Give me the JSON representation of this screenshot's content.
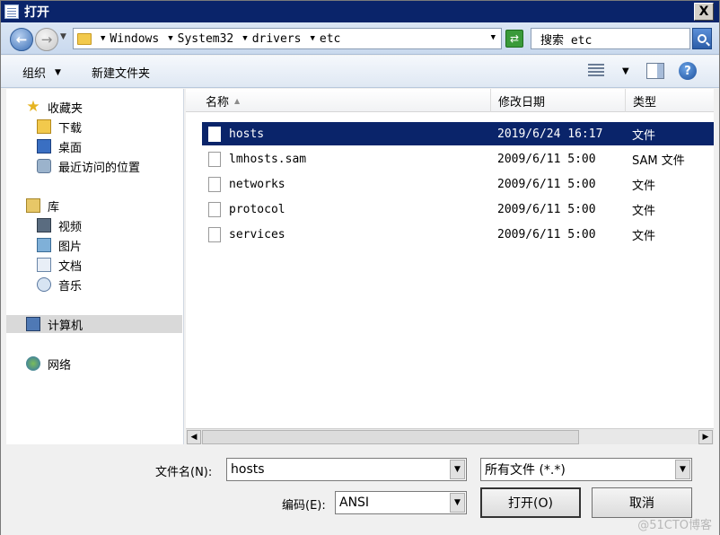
{
  "window": {
    "title": "打开",
    "close_label": "X"
  },
  "address": {
    "crumbs": [
      "Windows",
      "System32",
      "drivers",
      "etc"
    ]
  },
  "search": {
    "placeholder": "搜索 etc"
  },
  "toolbar": {
    "organize_label": "组织",
    "new_folder_label": "新建文件夹",
    "help_label": "?"
  },
  "nav": {
    "favorites": {
      "label": "收藏夹",
      "items": [
        "下载",
        "桌面",
        "最近访问的位置"
      ]
    },
    "libraries": {
      "label": "库",
      "items": [
        "视频",
        "图片",
        "文档",
        "音乐"
      ]
    },
    "computer": "计算机",
    "network": "网络"
  },
  "columns": {
    "name": "名称",
    "date": "修改日期",
    "type": "类型"
  },
  "files": [
    {
      "name": "hosts",
      "date": "2019/6/24 16:17",
      "type": "文件",
      "selected": true
    },
    {
      "name": "lmhosts.sam",
      "date": "2009/6/11 5:00",
      "type": "SAM 文件",
      "selected": false
    },
    {
      "name": "networks",
      "date": "2009/6/11 5:00",
      "type": "文件",
      "selected": false
    },
    {
      "name": "protocol",
      "date": "2009/6/11 5:00",
      "type": "文件",
      "selected": false
    },
    {
      "name": "services",
      "date": "2009/6/11 5:00",
      "type": "文件",
      "selected": false
    }
  ],
  "bottom": {
    "filename_label": "文件名(N):",
    "filename_value": "hosts",
    "filter_value": "所有文件 (*.*)",
    "encoding_label": "编码(E):",
    "encoding_value": "ANSI",
    "open_label": "打开(O)",
    "cancel_label": "取消"
  },
  "watermark": "@51CTO博客",
  "colors": {
    "titlebar": "#0a246a",
    "selection": "#0a246a"
  }
}
